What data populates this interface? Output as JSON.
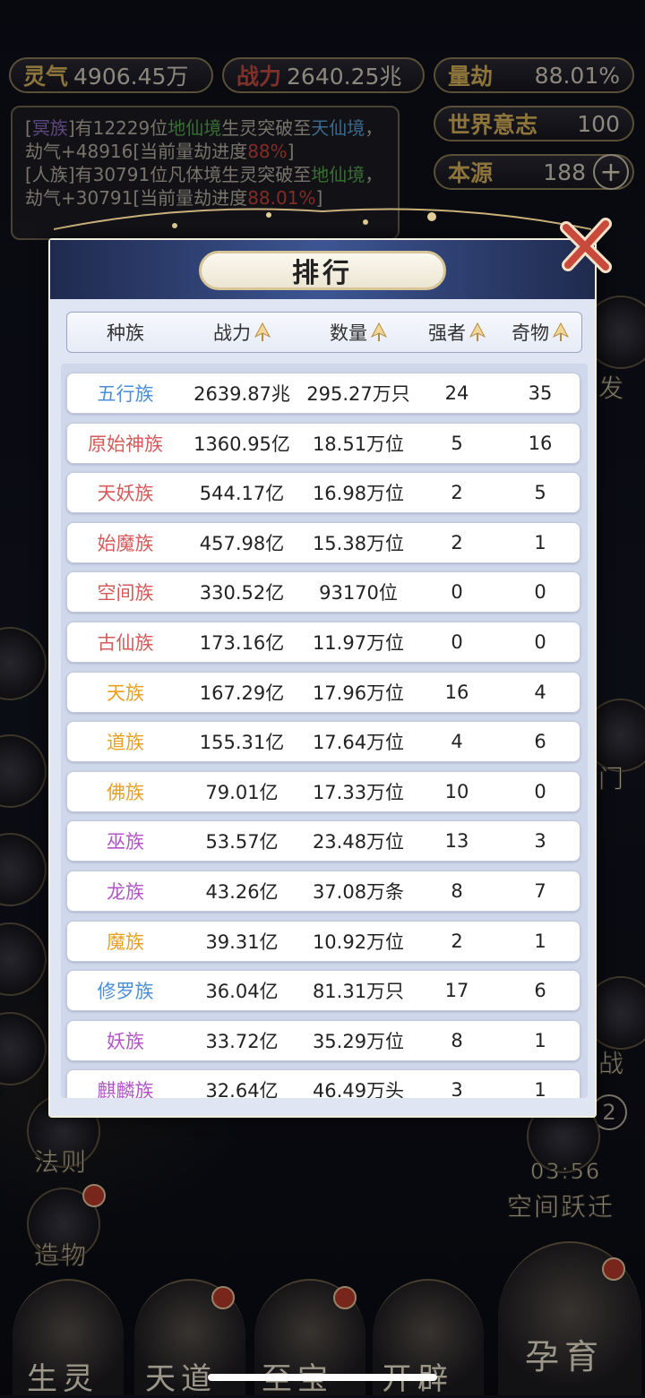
{
  "resources": {
    "lingqi": {
      "label": "灵气",
      "value": "4906.45万"
    },
    "zhanli": {
      "label": "战力",
      "value": "2640.25兆"
    },
    "liangjie": {
      "label": "量劫",
      "value": "88.01%"
    },
    "shijie": {
      "label": "世界意志",
      "value": "100"
    },
    "benyuan": {
      "label": "本源",
      "value": "188"
    },
    "plus": "+"
  },
  "log": {
    "line1": {
      "a": "[",
      "b": "冥族",
      "c": "]有12229位",
      "d": "地仙境",
      "e": "生灵突破至",
      "f": "天仙境",
      "g": "，劫气+48916[当前量劫进度",
      "h": "88%",
      "i": "]"
    },
    "line2": {
      "a": "[人族]有30791位凡体境生灵突破至",
      "b": "地仙境",
      "c": "，劫气+30791[当前量劫进度",
      "d": "88.01%",
      "e": "]"
    }
  },
  "side": {
    "right_top": "发",
    "right_mid": "门",
    "right_low": "战",
    "fa_ze": "法则",
    "zao_wu": "造物",
    "timer": "03:56",
    "kongjian": "空间跃迁",
    "badge": "2"
  },
  "bottom": [
    "生灵",
    "天道",
    "至宝",
    "开辟",
    "孕育"
  ],
  "modal": {
    "title": "排行",
    "columns": [
      "种族",
      "战力",
      "数量",
      "强者",
      "奇物"
    ],
    "rows": [
      {
        "name": "五行族",
        "color": "#4a8fd6",
        "power": "2639.87兆",
        "count": "295.27万只",
        "strong": "24",
        "treasure": "35"
      },
      {
        "name": "原始神族",
        "color": "#d65a5a",
        "power": "1360.95亿",
        "count": "18.51万位",
        "strong": "5",
        "treasure": "16"
      },
      {
        "name": "天妖族",
        "color": "#d65a5a",
        "power": "544.17亿",
        "count": "16.98万位",
        "strong": "2",
        "treasure": "5"
      },
      {
        "name": "始魔族",
        "color": "#d65a5a",
        "power": "457.98亿",
        "count": "15.38万位",
        "strong": "2",
        "treasure": "1"
      },
      {
        "name": "空间族",
        "color": "#d65a5a",
        "power": "330.52亿",
        "count": "93170位",
        "strong": "0",
        "treasure": "0"
      },
      {
        "name": "古仙族",
        "color": "#d65a5a",
        "power": "173.16亿",
        "count": "11.97万位",
        "strong": "0",
        "treasure": "0"
      },
      {
        "name": "天族",
        "color": "#e8a020",
        "power": "167.29亿",
        "count": "17.96万位",
        "strong": "16",
        "treasure": "4"
      },
      {
        "name": "道族",
        "color": "#e8a020",
        "power": "155.31亿",
        "count": "17.64万位",
        "strong": "4",
        "treasure": "6"
      },
      {
        "name": "佛族",
        "color": "#e8a020",
        "power": "79.01亿",
        "count": "17.33万位",
        "strong": "10",
        "treasure": "0"
      },
      {
        "name": "巫族",
        "color": "#b355c9",
        "power": "53.57亿",
        "count": "23.48万位",
        "strong": "13",
        "treasure": "3"
      },
      {
        "name": "龙族",
        "color": "#b355c9",
        "power": "43.26亿",
        "count": "37.08万条",
        "strong": "8",
        "treasure": "7"
      },
      {
        "name": "魔族",
        "color": "#e8a020",
        "power": "39.31亿",
        "count": "10.92万位",
        "strong": "2",
        "treasure": "1"
      },
      {
        "name": "修罗族",
        "color": "#4a8fd6",
        "power": "36.04亿",
        "count": "81.31万只",
        "strong": "17",
        "treasure": "6"
      },
      {
        "name": "妖族",
        "color": "#b355c9",
        "power": "33.72亿",
        "count": "35.29万位",
        "strong": "8",
        "treasure": "1"
      },
      {
        "name": "麒麟族",
        "color": "#b355c9",
        "power": "32.64亿",
        "count": "46.49万头",
        "strong": "3",
        "treasure": "1"
      }
    ]
  }
}
